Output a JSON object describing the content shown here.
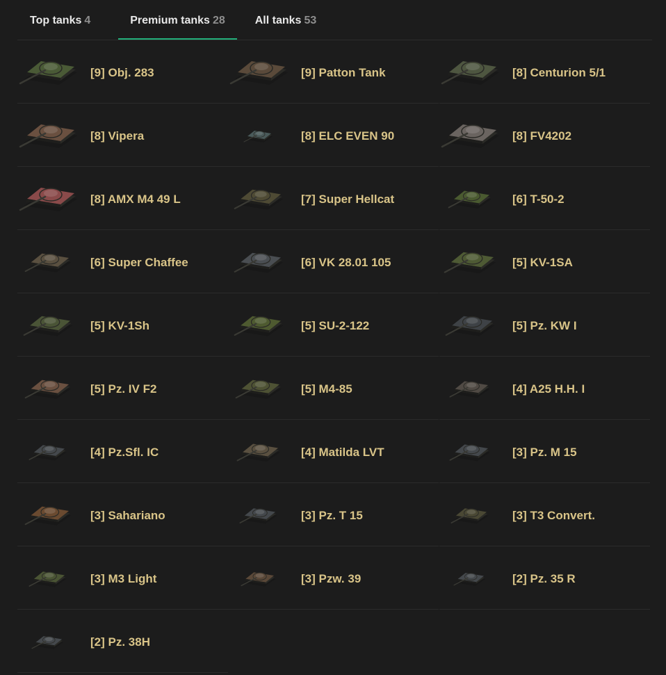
{
  "tabs": [
    {
      "label": "Top tanks",
      "count": "4"
    },
    {
      "label": "Premium tanks",
      "count": "28"
    },
    {
      "label": "All tanks",
      "count": "53"
    }
  ],
  "tanks": [
    {
      "name": "[9] Obj. 283",
      "color": "#4a5a36",
      "scale": 1.0
    },
    {
      "name": "[9] Patton Tank",
      "color": "#5a4a3a",
      "scale": 1.0
    },
    {
      "name": "[8] Centurion 5/1",
      "color": "#4e5640",
      "scale": 1.0
    },
    {
      "name": "[8] Vipera",
      "color": "#6a5040",
      "scale": 1.0
    },
    {
      "name": "[8] ELC EVEN 90",
      "color": "#4a5a5a",
      "scale": 0.5
    },
    {
      "name": "[8] FV4202",
      "color": "#6a6460",
      "scale": 1.0
    },
    {
      "name": "[8] AMX M4 49 L",
      "color": "#8a4a4a",
      "scale": 1.0
    },
    {
      "name": "[7] Super Hellcat",
      "color": "#4e4a34",
      "scale": 0.85
    },
    {
      "name": "[6] T-50-2",
      "color": "#4a5a30",
      "scale": 0.75
    },
    {
      "name": "[6] Super Chaffee",
      "color": "#5a5040",
      "scale": 0.8
    },
    {
      "name": "[6] VK 28.01 105",
      "color": "#4a4e52",
      "scale": 0.85
    },
    {
      "name": "[5] KV-1SA",
      "color": "#4e5a34",
      "scale": 0.9
    },
    {
      "name": "[5] KV-1Sh",
      "color": "#4a5436",
      "scale": 0.85
    },
    {
      "name": "[5] SU-2-122",
      "color": "#4e5a30",
      "scale": 0.85
    },
    {
      "name": "[5] Pz. KW I",
      "color": "#3e4246",
      "scale": 0.85
    },
    {
      "name": "[5] Pz. IV F2",
      "color": "#6a5040",
      "scale": 0.8
    },
    {
      "name": "[5] M4-85",
      "color": "#4e5234",
      "scale": 0.8
    },
    {
      "name": "[4] A25 H.H. I",
      "color": "#504a44",
      "scale": 0.7
    },
    {
      "name": "[4] Pz.Sfl. IC",
      "color": "#44484c",
      "scale": 0.65
    },
    {
      "name": "[4] Matilda LVT",
      "color": "#5a5040",
      "scale": 0.75
    },
    {
      "name": "[3] Pz. M 15",
      "color": "#44484c",
      "scale": 0.7
    },
    {
      "name": "[3] Sahariano",
      "color": "#6a4a30",
      "scale": 0.8
    },
    {
      "name": "[3] Pz. T 15",
      "color": "#44484c",
      "scale": 0.65
    },
    {
      "name": "[3] T3 Convert.",
      "color": "#4a4834",
      "scale": 0.65
    },
    {
      "name": "[3] M3 Light",
      "color": "#4a5434",
      "scale": 0.65
    },
    {
      "name": "[3] Pzw. 39",
      "color": "#5a4838",
      "scale": 0.6
    },
    {
      "name": "[2] Pz. 35 R",
      "color": "#44484c",
      "scale": 0.55
    },
    {
      "name": "[2] Pz. 38H",
      "color": "#44484c",
      "scale": 0.55
    }
  ]
}
